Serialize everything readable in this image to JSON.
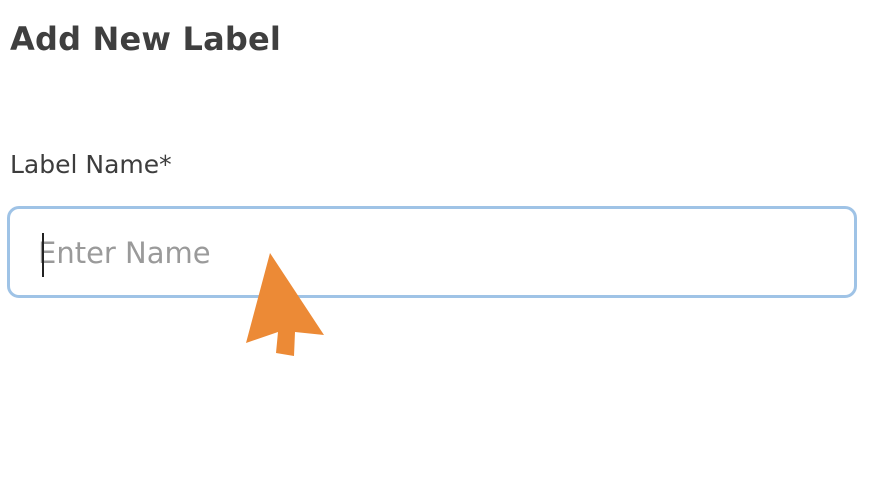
{
  "dialog": {
    "title": "Add New Label",
    "field_label": "Label Name*",
    "name_placeholder": "Enter Name",
    "name_value": ""
  },
  "colors": {
    "title_text": "#3f3f3f",
    "input_border": "#9fc3e6",
    "placeholder_text": "#9a9a9a",
    "cursor_arrow": "#ec8a36"
  },
  "icons": {
    "cursor": "arrow-cursor-icon"
  }
}
